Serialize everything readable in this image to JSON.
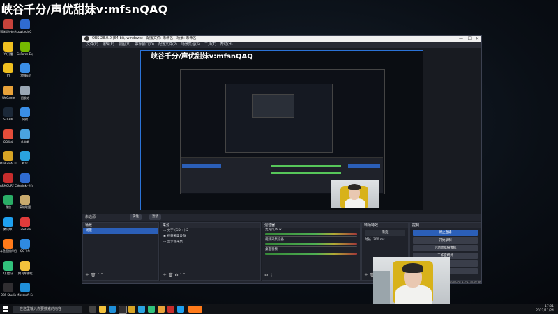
{
  "stream_overlay": {
    "title": "峡谷千分/声优甜妹v:mfsnQAQ"
  },
  "desktop_icons": [
    {
      "label": "郑张会计峡谷",
      "color": "#c7433b"
    },
    {
      "label": "Logitech G HUB",
      "color": "#2f6bd0"
    },
    {
      "label": "YY开播",
      "color": "#f0c020"
    },
    {
      "label": "GeForce Experience",
      "color": "#76b900"
    },
    {
      "label": "YY",
      "color": "#f0c020"
    },
    {
      "label": "比特精灵",
      "color": "#3a8ee6"
    },
    {
      "label": "WeGame",
      "color": "#e8a23a"
    },
    {
      "label": "回收站",
      "color": "#9aa7b5"
    },
    {
      "label": "STEAM",
      "color": "#1b2838"
    },
    {
      "label": "网络",
      "color": "#3a8ee6"
    },
    {
      "label": "QQ游戏",
      "color": "#e44d3a"
    },
    {
      "label": "此电脑",
      "color": "#4aa3df"
    },
    {
      "label": "PUBG BATTLEGR...",
      "color": "#d7a425"
    },
    {
      "label": "KOK",
      "color": "#2aa3e0"
    },
    {
      "label": "ARMOURY CRATE",
      "color": "#c72d2d"
    },
    {
      "label": "Yealink - 钉度文化",
      "color": "#2f6bd0"
    },
    {
      "label": "微信",
      "color": "#2aae67"
    },
    {
      "label": "英雄联盟",
      "color": "#c8aa6e"
    },
    {
      "label": "腾讯QQ",
      "color": "#1ea0f0"
    },
    {
      "label": "GeeGee",
      "color": "#e03b3b"
    },
    {
      "label": "斗鱼直播伴侣",
      "color": "#ff7a1a"
    },
    {
      "label": "QQ飞车",
      "color": "#2f8ae0"
    },
    {
      "label": "QQ音乐",
      "color": "#31c27c"
    },
    {
      "label": "QQ飞车辅助工具",
      "color": "#f3c23c"
    },
    {
      "label": "OBS Studio",
      "color": "#302e31"
    },
    {
      "label": "Microsoft Edge",
      "color": "#1f8fd8"
    }
  ],
  "obs": {
    "window_title": "OBS 28.0.0 (64-bit, windows) - 配置文件: 未命名 - 场景: 未命名",
    "window_controls": [
      "—",
      "☐",
      "✕"
    ],
    "menu": [
      "文件(F)",
      "编辑(E)",
      "视图(V)",
      "停靠窗口(D)",
      "配置文件(P)",
      "场景集合(S)",
      "工具(T)",
      "帮助(H)"
    ],
    "toolbar": {
      "label": "未选源",
      "properties": "属性",
      "filters": "滤镜"
    },
    "scenes": {
      "header": "场景",
      "items": [
        "场景"
      ]
    },
    "sources": {
      "header": "来源",
      "items": [
        "文字 (GDI+) 2",
        "视频采集设备",
        "显示器采集"
      ]
    },
    "audio": {
      "header": "混音器",
      "channels": [
        {
          "name": "麦克风/Aux",
          "db": "0.0 dB"
        },
        {
          "name": "视频采集设备",
          "db": "0.0 dB"
        },
        {
          "name": "桌面音频",
          "db": "0.0 dB"
        }
      ]
    },
    "transitions": {
      "header": "转场特效",
      "type": "渐变",
      "duration_label": "时长",
      "duration": "300 ms"
    },
    "controls": {
      "header": "控制",
      "buttons": [
        "停止直播",
        "开始录制",
        "启动虚拟摄像机",
        "工作室模式",
        "设置",
        "退出"
      ]
    },
    "status": {
      "text": "LIVE: 00:00:00  REC: 00:00:00  CPU: 1.2%, 30.00 fps"
    }
  },
  "taskbar": {
    "search_placeholder": "在这里输入你要搜索的内容",
    "time": "17:01",
    "date": "2022/11/24"
  }
}
